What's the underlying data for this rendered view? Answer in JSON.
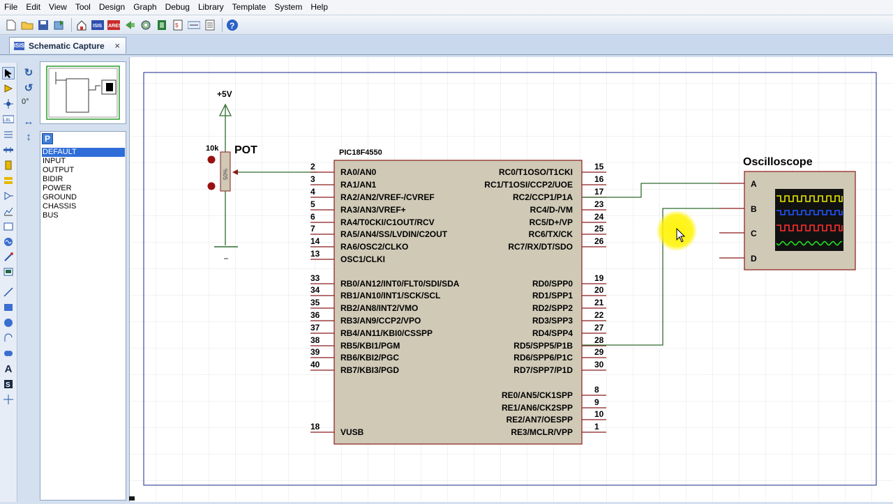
{
  "menu": [
    "File",
    "Edit",
    "View",
    "Tool",
    "Design",
    "Graph",
    "Debug",
    "Library",
    "Template",
    "System",
    "Help"
  ],
  "tab": {
    "label": "Schematic Capture",
    "close": "×"
  },
  "rotation": {
    "angle": "0°"
  },
  "device_panel": {
    "p_button": "P",
    "items": [
      "DEFAULT",
      "INPUT",
      "OUTPUT",
      "BIDIR",
      "POWER",
      "GROUND",
      "CHASSIS",
      "BUS"
    ],
    "selected": "DEFAULT"
  },
  "schematic": {
    "power_label": "+5V",
    "pot": {
      "name": "POT",
      "value": "10k",
      "position": "50%"
    },
    "mcu": {
      "name": "PIC18F4550",
      "left_pins": [
        {
          "num": "2",
          "label": "RA0/AN0"
        },
        {
          "num": "3",
          "label": "RA1/AN1"
        },
        {
          "num": "4",
          "label": "RA2/AN2/VREF-/CVREF"
        },
        {
          "num": "5",
          "label": "RA3/AN3/VREF+"
        },
        {
          "num": "6",
          "label": "RA4/T0CKI/C1OUT/RCV"
        },
        {
          "num": "7",
          "label": "RA5/AN4/SS/LVDIN/C2OUT"
        },
        {
          "num": "14",
          "label": "RA6/OSC2/CLKO"
        },
        {
          "num": "13",
          "label": "OSC1/CLKI"
        },
        {
          "num": "33",
          "label": "RB0/AN12/INT0/FLT0/SDI/SDA"
        },
        {
          "num": "34",
          "label": "RB1/AN10/INT1/SCK/SCL"
        },
        {
          "num": "35",
          "label": "RB2/AN8/INT2/VMO"
        },
        {
          "num": "36",
          "label": "RB3/AN9/CCP2/VPO"
        },
        {
          "num": "37",
          "label": "RB4/AN11/KBI0/CSSPP"
        },
        {
          "num": "38",
          "label": "RB5/KBI1/PGM"
        },
        {
          "num": "39",
          "label": "RB6/KBI2/PGC"
        },
        {
          "num": "40",
          "label": "RB7/KBI3/PGD"
        },
        {
          "num": "18",
          "label": "VUSB"
        }
      ],
      "right_pins": [
        {
          "num": "15",
          "label": "RC0/T1OSO/T1CKI"
        },
        {
          "num": "16",
          "label": "RC1/T1OSI/CCP2/UOE"
        },
        {
          "num": "17",
          "label": "RC2/CCP1/P1A"
        },
        {
          "num": "23",
          "label": "RC4/D-/VM"
        },
        {
          "num": "24",
          "label": "RC5/D+/VP"
        },
        {
          "num": "25",
          "label": "RC6/TX/CK"
        },
        {
          "num": "26",
          "label": "RC7/RX/DT/SDO"
        },
        {
          "num": "19",
          "label": "RD0/SPP0"
        },
        {
          "num": "20",
          "label": "RD1/SPP1"
        },
        {
          "num": "21",
          "label": "RD2/SPP2"
        },
        {
          "num": "22",
          "label": "RD3/SPP3"
        },
        {
          "num": "27",
          "label": "RD4/SPP4"
        },
        {
          "num": "28",
          "label": "RD5/SPP5/P1B"
        },
        {
          "num": "29",
          "label": "RD6/SPP6/P1C"
        },
        {
          "num": "30",
          "label": "RD7/SPP7/P1D"
        },
        {
          "num": "8",
          "label": "RE0/AN5/CK1SPP"
        },
        {
          "num": "9",
          "label": "RE1/AN6/CK2SPP"
        },
        {
          "num": "10",
          "label": "RE2/AN7/OESPP"
        },
        {
          "num": "1",
          "label": "RE3/MCLR/VPP"
        }
      ]
    },
    "scope": {
      "title": "Oscilloscope",
      "channels": [
        "A",
        "B",
        "C",
        "D"
      ]
    }
  },
  "colors": {
    "wire": "#2f6b2f",
    "component_fill": "#cfc9b6",
    "component_stroke": "#8b1a1a",
    "grid": "#e3e3e3",
    "trace_a": "#e8e800",
    "trace_b": "#2255ff",
    "trace_c": "#ff3030",
    "trace_d": "#20e020"
  }
}
